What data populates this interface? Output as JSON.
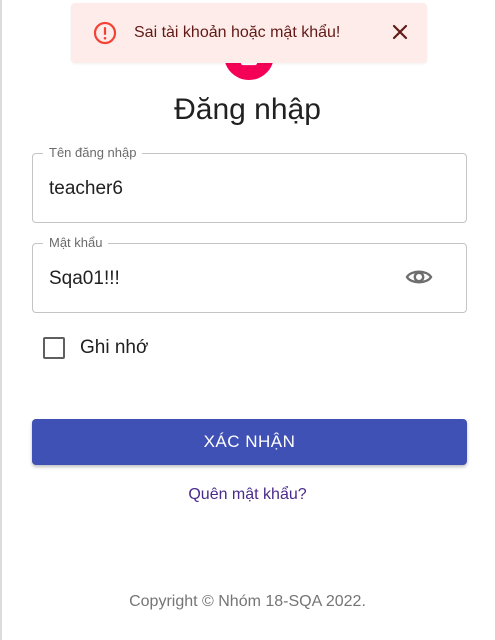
{
  "alert": {
    "message": "Sai tài khoản hoặc mật khẩu!",
    "icon": "error-outline-icon",
    "close_icon": "close-icon",
    "background": "#fdecea",
    "accent": "#f44336"
  },
  "avatar": {
    "icon": "lock-icon",
    "color": "#f50057"
  },
  "form": {
    "title": "Đăng nhập",
    "username": {
      "label": "Tên đăng nhập",
      "value": "teacher6"
    },
    "password": {
      "label": "Mật khẩu",
      "value": "Sqa01!!!",
      "toggle_icon": "eye-icon"
    },
    "remember": {
      "label": "Ghi nhớ",
      "checked": false
    },
    "submit_label": "XÁC NHẬN",
    "submit_color": "#3f51b5",
    "forgot_link": "Quên mật khẩu?"
  },
  "footer": {
    "copyright": "Copyright © Nhóm 18-SQA 2022."
  }
}
